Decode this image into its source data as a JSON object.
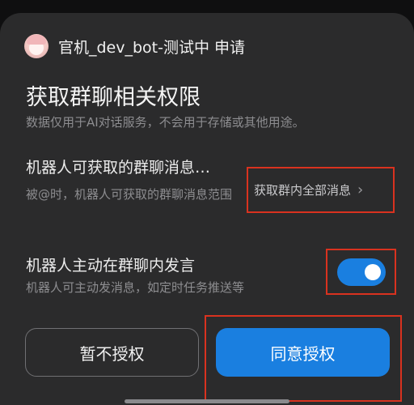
{
  "header": {
    "avatar_icon": "avatar-icon",
    "title": "官机_dev_bot-测试中 申请"
  },
  "permission": {
    "title": "获取群聊相关权限",
    "subtitle": "数据仅用于AI对话服务，不会用于存储或其他用途。"
  },
  "group_messages": {
    "title": "机器人可获取的群聊消息…",
    "description": "被@时，机器人可获取的群聊消息范围",
    "value": "获取群内全部消息",
    "chevron_icon": "chevron-right-icon"
  },
  "proactive_speaking": {
    "title": "机器人主动在群聊内发言",
    "description": "机器人可主动发消息，如定时任务推送等",
    "enabled": true
  },
  "actions": {
    "deny_label": "暂不授权",
    "agree_label": "同意授权"
  },
  "colors": {
    "accent": "#1a7fe0",
    "highlight_box": "#d9321f",
    "sheet_background": "#2b2b2c"
  }
}
